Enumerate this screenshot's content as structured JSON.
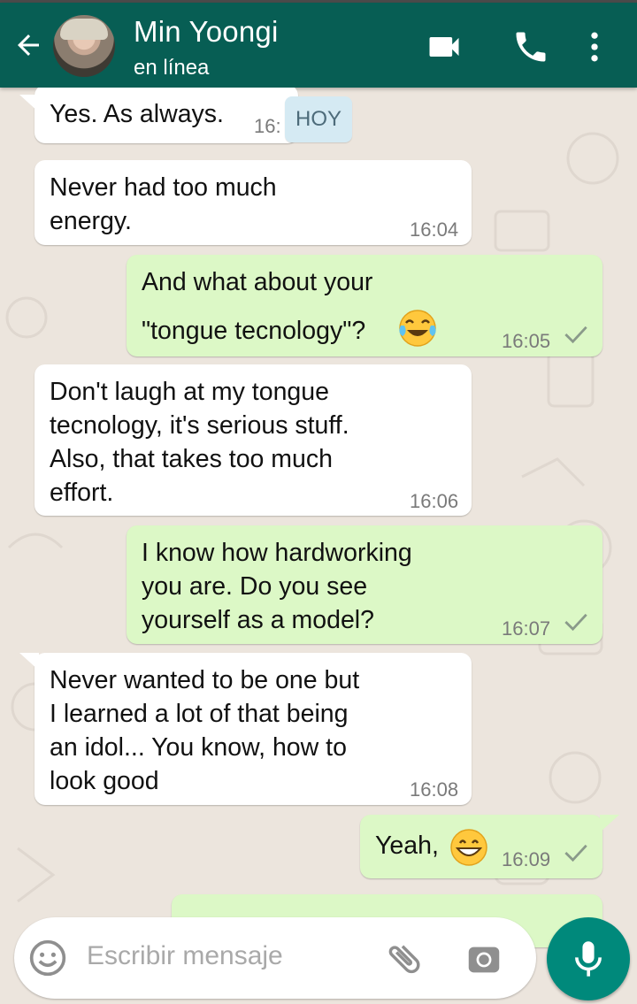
{
  "header": {
    "contact_name": "Min Yoongi",
    "status": "en línea",
    "back_icon": "arrow-back-icon",
    "actions": [
      "video-call-icon",
      "voice-call-icon",
      "more-vert-icon"
    ]
  },
  "date_label": "HOY",
  "messages": [
    {
      "dir": "in",
      "text": "Yes. As always.",
      "time": "16:"
    },
    {
      "dir": "in",
      "text": "Never had too much\nenergy.",
      "time": "16:04"
    },
    {
      "dir": "out",
      "text": "And what about your",
      "text2": "\"tongue tecnology\"?",
      "emoji": "face-with-tears-of-joy",
      "time": "16:05",
      "ticks": "sent"
    },
    {
      "dir": "in",
      "text": "Don't laugh at my tongue\ntecnology, it's serious stuff.\nAlso, that takes too much\neffort.",
      "time": "16:06"
    },
    {
      "dir": "out",
      "text": "I know how hardworking\nyou are. Do you see\nyourself as a model?",
      "time": "16:07",
      "ticks": "sent"
    },
    {
      "dir": "in",
      "text": "Never wanted to be one but\nI learned a lot of that being\nan idol... You know, how to\nlook good",
      "time": "16:08"
    },
    {
      "dir": "out",
      "text": "Yeah,",
      "emoji": "grinning-face",
      "time": "16:09",
      "ticks": "sent"
    }
  ],
  "composer": {
    "placeholder": "Escribir mensaje",
    "icons": [
      "emoji-icon",
      "attach-icon",
      "camera-icon",
      "mic-icon"
    ]
  },
  "colors": {
    "header": "#075E54",
    "chat_bg": "#ECE5DD",
    "outgoing": "#DCF8C6",
    "incoming": "#FFFFFF",
    "mic_button": "#00897B"
  }
}
